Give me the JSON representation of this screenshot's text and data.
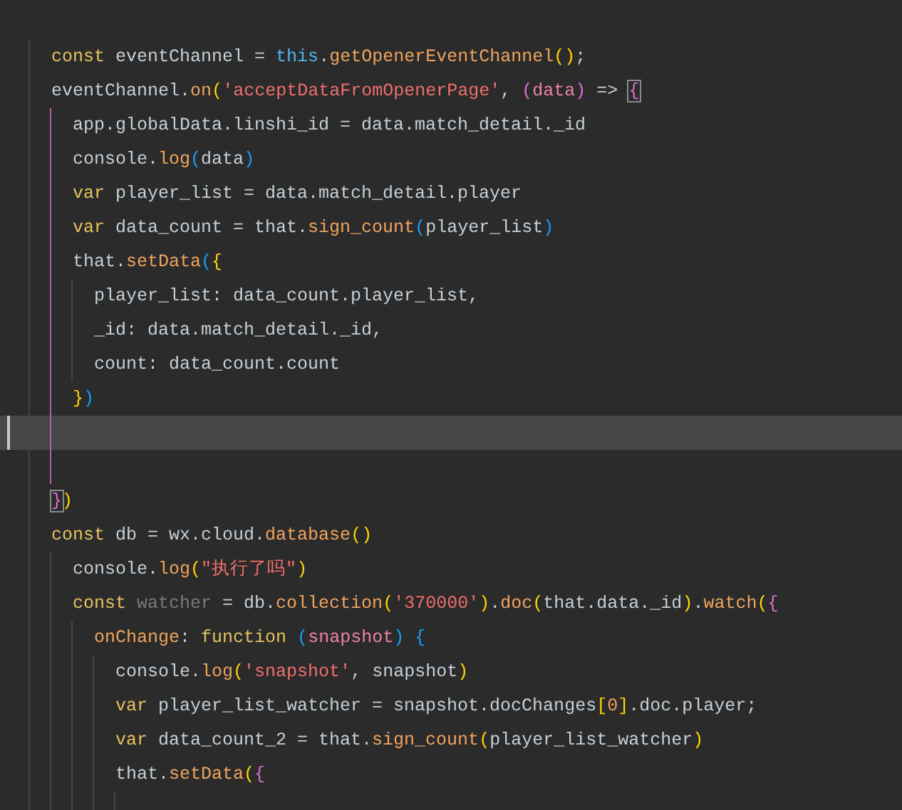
{
  "editor": {
    "lines": [
      {
        "current": false,
        "active": false,
        "tokens": [
          {
            "kind": "kw",
            "text": "const"
          },
          {
            "kind": "plain",
            "text": " eventChannel = "
          },
          {
            "kind": "this",
            "text": "this"
          },
          {
            "kind": "plain",
            "text": "."
          },
          {
            "kind": "fn",
            "text": "getOpenerEventChannel"
          },
          {
            "kind": "b1",
            "text": "()"
          },
          {
            "kind": "plain",
            "text": ";"
          }
        ]
      },
      {
        "current": false,
        "active": true,
        "tokens": [
          {
            "kind": "plain",
            "text": "eventChannel."
          },
          {
            "kind": "fn",
            "text": "on"
          },
          {
            "kind": "b1",
            "text": "("
          },
          {
            "kind": "str",
            "text": "'acceptDataFromOpenerPage'"
          },
          {
            "kind": "plain",
            "text": ", "
          },
          {
            "kind": "b2",
            "text": "("
          },
          {
            "kind": "param",
            "text": "data"
          },
          {
            "kind": "b2",
            "text": ")"
          },
          {
            "kind": "plain",
            "text": " => "
          },
          {
            "kind": "b2match",
            "text": "{"
          }
        ],
        "children": [
          {
            "current": false,
            "active": false,
            "tokens": [
              {
                "kind": "plain",
                "text": "app.globalData.linshi_id = data.match_detail._id"
              }
            ]
          },
          {
            "current": false,
            "active": false,
            "tokens": [
              {
                "kind": "plain",
                "text": "console."
              },
              {
                "kind": "fn",
                "text": "log"
              },
              {
                "kind": "b3",
                "text": "("
              },
              {
                "kind": "plain",
                "text": "data"
              },
              {
                "kind": "b3",
                "text": ")"
              }
            ]
          },
          {
            "current": false,
            "active": false,
            "tokens": [
              {
                "kind": "kw",
                "text": "var"
              },
              {
                "kind": "plain",
                "text": " player_list = data.match_detail.player"
              }
            ]
          },
          {
            "current": false,
            "active": false,
            "tokens": [
              {
                "kind": "kw",
                "text": "var"
              },
              {
                "kind": "plain",
                "text": " data_count = that."
              },
              {
                "kind": "fn",
                "text": "sign_count"
              },
              {
                "kind": "b3",
                "text": "("
              },
              {
                "kind": "plain",
                "text": "player_list"
              },
              {
                "kind": "b3",
                "text": ")"
              }
            ]
          },
          {
            "current": false,
            "active": false,
            "tokens": [
              {
                "kind": "plain",
                "text": "that."
              },
              {
                "kind": "fn",
                "text": "setData"
              },
              {
                "kind": "b3",
                "text": "("
              },
              {
                "kind": "b1",
                "text": "{"
              }
            ],
            "children": [
              {
                "current": false,
                "active": false,
                "tokens": [
                  {
                    "kind": "plain",
                    "text": "player_list: data_count.player_list,"
                  }
                ]
              },
              {
                "current": false,
                "active": false,
                "tokens": [
                  {
                    "kind": "plain",
                    "text": "_id: data.match_detail._id,"
                  }
                ]
              },
              {
                "current": false,
                "active": false,
                "tokens": [
                  {
                    "kind": "plain",
                    "text": "count: data_count.count"
                  }
                ]
              }
            ]
          },
          {
            "current": false,
            "active": false,
            "tokens": [
              {
                "kind": "b1",
                "text": "}"
              },
              {
                "kind": "b3",
                "text": ")"
              }
            ]
          },
          {
            "current": true,
            "active": false
          },
          {
            "current": false,
            "active": false
          }
        ]
      },
      {
        "current": false,
        "active": false,
        "tokens": [
          {
            "kind": "b2match",
            "text": "}"
          },
          {
            "kind": "b1",
            "text": ")"
          }
        ]
      },
      {
        "current": false,
        "active": false,
        "tokens": [
          {
            "kind": "kw",
            "text": "const"
          },
          {
            "kind": "plain",
            "text": " db = wx.cloud."
          },
          {
            "kind": "fn",
            "text": "database"
          },
          {
            "kind": "b1",
            "text": "()"
          }
        ],
        "children": [
          {
            "current": false,
            "active": false,
            "tokens": [
              {
                "kind": "plain",
                "text": "console."
              },
              {
                "kind": "fn",
                "text": "log"
              },
              {
                "kind": "b1",
                "text": "("
              },
              {
                "kind": "str",
                "text": "\"执行了吗\""
              },
              {
                "kind": "b1",
                "text": ")"
              }
            ]
          },
          {
            "current": false,
            "active": false,
            "tokens": [
              {
                "kind": "kw",
                "text": "const "
              },
              {
                "kind": "dim",
                "text": "watcher"
              },
              {
                "kind": "plain",
                "text": " = db."
              },
              {
                "kind": "fn",
                "text": "collection"
              },
              {
                "kind": "b1",
                "text": "("
              },
              {
                "kind": "str",
                "text": "'370000'"
              },
              {
                "kind": "b1",
                "text": ")"
              },
              {
                "kind": "plain",
                "text": "."
              },
              {
                "kind": "fn",
                "text": "doc"
              },
              {
                "kind": "b1",
                "text": "("
              },
              {
                "kind": "plain",
                "text": "that.data._id"
              },
              {
                "kind": "b1",
                "text": ")"
              },
              {
                "kind": "plain",
                "text": "."
              },
              {
                "kind": "fn",
                "text": "watch"
              },
              {
                "kind": "b1",
                "text": "("
              },
              {
                "kind": "b2",
                "text": "{"
              }
            ],
            "children": [
              {
                "current": false,
                "active": false,
                "tokens": [
                  {
                    "kind": "fn",
                    "text": "onChange"
                  },
                  {
                    "kind": "plain",
                    "text": ": "
                  },
                  {
                    "kind": "kw",
                    "text": "function "
                  },
                  {
                    "kind": "b3",
                    "text": "("
                  },
                  {
                    "kind": "param",
                    "text": "snapshot"
                  },
                  {
                    "kind": "b3",
                    "text": ") {"
                  }
                ],
                "children": [
                  {
                    "current": false,
                    "active": false,
                    "tokens": [
                      {
                        "kind": "plain",
                        "text": "console."
                      },
                      {
                        "kind": "fn",
                        "text": "log"
                      },
                      {
                        "kind": "b1",
                        "text": "("
                      },
                      {
                        "kind": "str",
                        "text": "'snapshot'"
                      },
                      {
                        "kind": "plain",
                        "text": ", snapshot"
                      },
                      {
                        "kind": "b1",
                        "text": ")"
                      }
                    ]
                  },
                  {
                    "current": false,
                    "active": false,
                    "tokens": [
                      {
                        "kind": "kw",
                        "text": "var"
                      },
                      {
                        "kind": "plain",
                        "text": " player_list_watcher = snapshot.docChanges"
                      },
                      {
                        "kind": "b1",
                        "text": "["
                      },
                      {
                        "kind": "num",
                        "text": "0"
                      },
                      {
                        "kind": "b1",
                        "text": "]"
                      },
                      {
                        "kind": "plain",
                        "text": ".doc.player;"
                      }
                    ]
                  },
                  {
                    "current": false,
                    "active": false,
                    "tokens": [
                      {
                        "kind": "kw",
                        "text": "var"
                      },
                      {
                        "kind": "plain",
                        "text": " data_count_2 = that."
                      },
                      {
                        "kind": "fn",
                        "text": "sign_count"
                      },
                      {
                        "kind": "b1",
                        "text": "("
                      },
                      {
                        "kind": "plain",
                        "text": "player_list_watcher"
                      },
                      {
                        "kind": "b1",
                        "text": ")"
                      }
                    ]
                  },
                  {
                    "current": false,
                    "active": false,
                    "tokens": [
                      {
                        "kind": "plain",
                        "text": "that."
                      },
                      {
                        "kind": "fn",
                        "text": "setData"
                      },
                      {
                        "kind": "b1",
                        "text": "("
                      },
                      {
                        "kind": "b2",
                        "text": "{"
                      }
                    ],
                    "children": [
                      {
                        "current": false,
                        "active": false
                      }
                    ]
                  }
                ]
              }
            ]
          }
        ]
      }
    ]
  }
}
